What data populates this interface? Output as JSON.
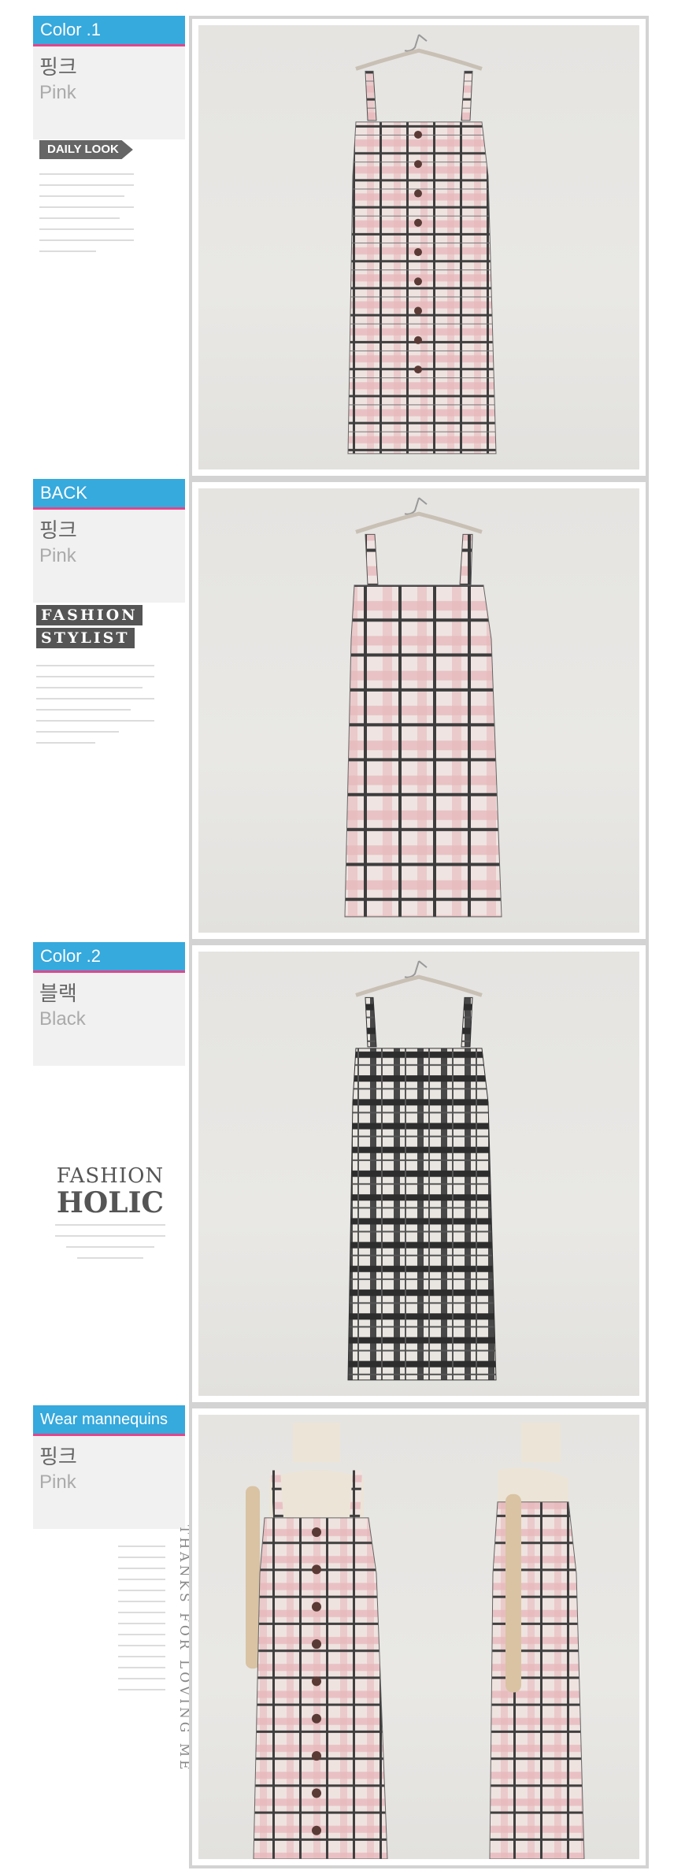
{
  "sections": [
    {
      "tag": "Color .1",
      "name_ko": "핑크",
      "name_en": "Pink",
      "extra": "DAILY LOOK"
    },
    {
      "tag": "BACK",
      "name_ko": "핑크",
      "name_en": "Pink",
      "extra_line1": "FASHION",
      "extra_line2": "STYLIST"
    },
    {
      "tag": "Color .2",
      "name_ko": "블랙",
      "name_en": "Black",
      "extra_line1": "FASHION",
      "extra_line2": "HOLIC"
    },
    {
      "tag": "Wear mannequins",
      "name_ko": "핑크",
      "name_en": "Pink",
      "extra": "THANKS FOR LOVING ME"
    }
  ],
  "colors": {
    "tag_bg": "#36a9dd",
    "tag_line": "#e0468c",
    "frame": "#d3d3d3"
  }
}
